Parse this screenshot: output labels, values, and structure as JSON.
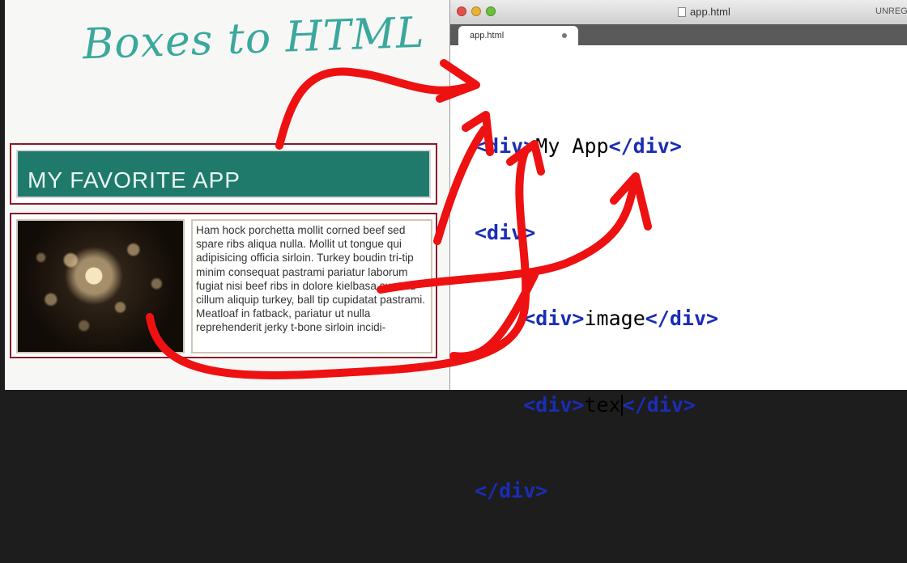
{
  "board": {
    "title": "Boxes to HTML",
    "header_text": "MY FAVORITE APP",
    "body_text": "Ham hock porchetta mollit corned beef sed spare ribs aliqua nulla. Mollit ut tongue qui adipisicing officia sirloin. Turkey boudin tri-tip minim consequat pastrami pariatur laborum fugiat nisi beef ribs in dolore kielbasa sunt. Id cillum aliquip turkey, ball tip cupidatat pastrami. Meatloaf in fatback, pariatur ut nulla reprehenderit jerky t-bone sirloin incidi-"
  },
  "editor": {
    "window_title": "app.html",
    "unregistered": "UNREGI",
    "tab_label": "app.html",
    "code": {
      "l1": {
        "open": "<div>",
        "text": "My App",
        "close": "</div>"
      },
      "l2": {
        "open": "<div>"
      },
      "l3": {
        "indent": "    ",
        "open": "<div>",
        "text": "image",
        "close": "</div>"
      },
      "l4": {
        "indent": "    ",
        "open": "<div>",
        "text": "tex",
        "close": "</div>"
      },
      "l5": {
        "close": "</div>"
      }
    }
  },
  "colors": {
    "annotation": "#ee1111",
    "header_bar": "#1f7a6c",
    "box_border": "#8a1a2a",
    "tag": "#1a2db5",
    "handwriting": "#3aa89c"
  }
}
